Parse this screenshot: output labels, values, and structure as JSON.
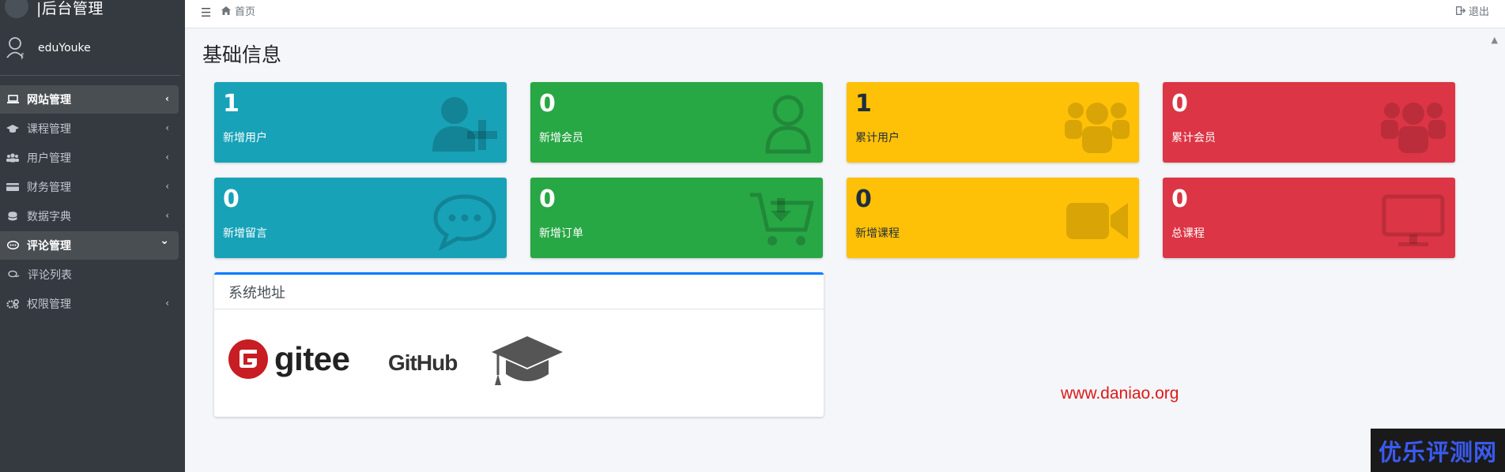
{
  "sidebar": {
    "brand": "|后台管理",
    "user": "eduYouke",
    "items": [
      {
        "label": "网站管理",
        "arrow": "‹"
      },
      {
        "label": "课程管理",
        "arrow": "‹"
      },
      {
        "label": "用户管理",
        "arrow": "‹"
      },
      {
        "label": "财务管理",
        "arrow": "‹"
      },
      {
        "label": "数据字典",
        "arrow": "‹"
      },
      {
        "label": "评论管理",
        "arrow": "⌄"
      },
      {
        "label": "评论列表"
      },
      {
        "label": "权限管理",
        "arrow": "‹"
      }
    ]
  },
  "topbar": {
    "menu_icon": "☰",
    "breadcrumb": "首页",
    "logout": "退出"
  },
  "page": {
    "title": "基础信息"
  },
  "stats": [
    {
      "value": "1",
      "label": "新增用户",
      "icon": "user-plus-icon",
      "color": "#17a2b8"
    },
    {
      "value": "0",
      "label": "新增会员",
      "icon": "user-icon",
      "color": "#28a745"
    },
    {
      "value": "1",
      "label": "累计用户",
      "icon": "users-icon",
      "color": "#ffc107"
    },
    {
      "value": "0",
      "label": "累计会员",
      "icon": "users-icon",
      "color": "#dc3545"
    },
    {
      "value": "0",
      "label": "新增留言",
      "icon": "comment-dots-icon",
      "color": "#17a2b8"
    },
    {
      "value": "0",
      "label": "新增订单",
      "icon": "cart-download-icon",
      "color": "#28a745"
    },
    {
      "value": "0",
      "label": "新增课程",
      "icon": "video-icon",
      "color": "#ffc107"
    },
    {
      "value": "0",
      "label": "总课程",
      "icon": "desktop-icon",
      "color": "#dc3545"
    }
  ],
  "system_card": {
    "title": "系统地址",
    "links": [
      {
        "label": "gitee",
        "icon": "gitee-logo-icon"
      },
      {
        "label": "GitHub",
        "icon": "github-logo-icon"
      },
      {
        "label": "",
        "icon": "graduation-cap-icon"
      }
    ]
  },
  "site_link": "www.daniao.org",
  "watermark": "优乐评测网",
  "colors": {
    "sidebar": "#343a40",
    "accent": "#007bff",
    "link": "#e01818"
  }
}
